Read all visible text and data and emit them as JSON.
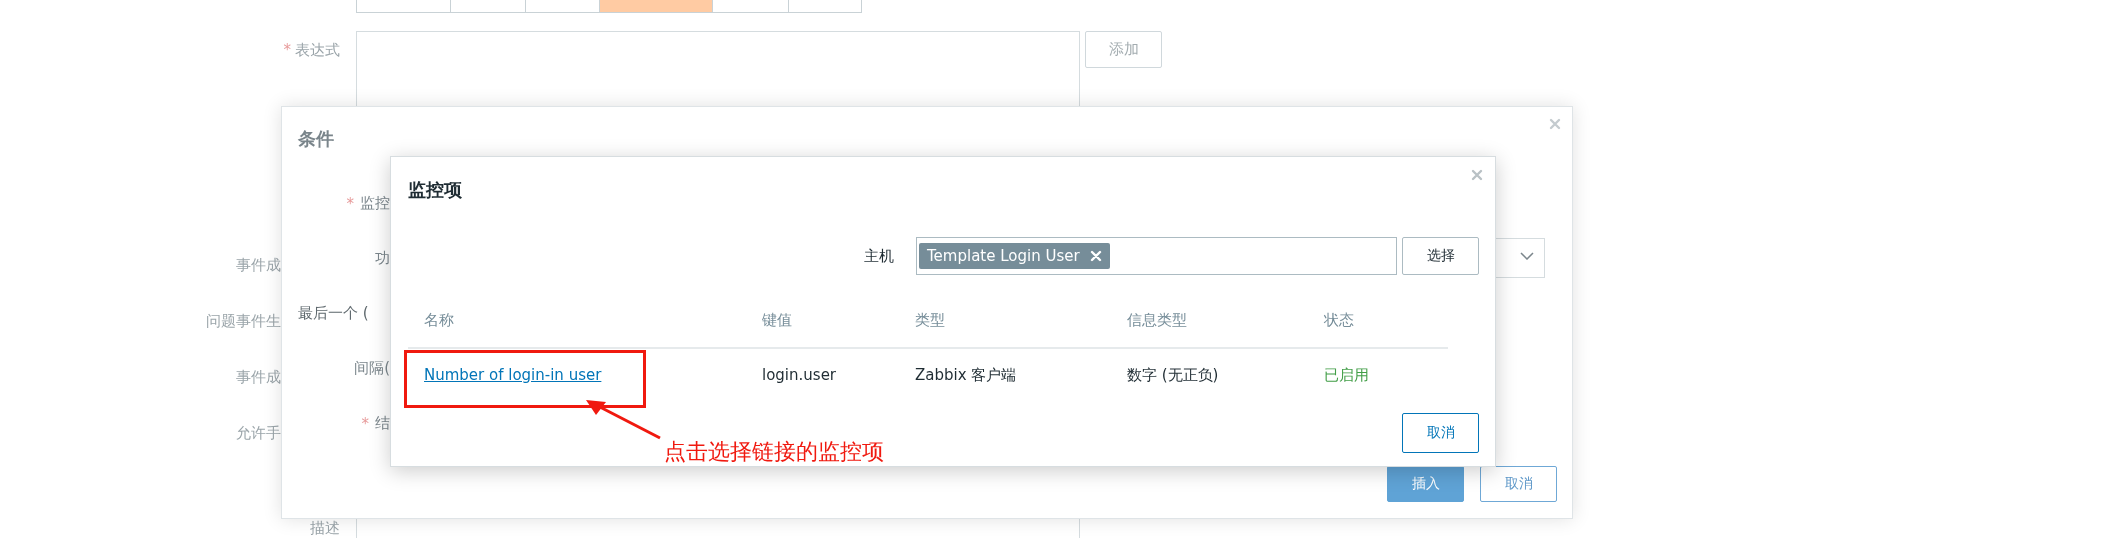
{
  "background_form": {
    "severity_buttons": [
      {
        "selected": false
      },
      {
        "selected": false
      },
      {
        "selected": false
      },
      {
        "selected": true
      },
      {
        "selected": false
      },
      {
        "selected": false
      }
    ],
    "expression": {
      "required_mark": "*",
      "label": "表达式",
      "add_button": "添加"
    },
    "side_labels": [
      "事件成",
      "问题事件生",
      "事件成",
      "允许手"
    ],
    "description_label": "描述"
  },
  "condition_dialog": {
    "title": "条件",
    "fields": [
      {
        "kind": "field",
        "required_mark": "*",
        "label": "监控"
      },
      {
        "kind": "field",
        "label": "功"
      },
      {
        "kind": "heading",
        "label": "最后一个 ("
      },
      {
        "kind": "field",
        "label": "间隔("
      },
      {
        "kind": "field",
        "required_mark": "*",
        "label": "结"
      }
    ],
    "buttons": [
      {
        "label": "插入",
        "kind": "primary"
      },
      {
        "label": "取消",
        "kind": "secondary"
      }
    ]
  },
  "item_dialog": {
    "title": "监控项",
    "host_label": "主机",
    "host_tags": [
      "Template Login User"
    ],
    "select_button": "选择",
    "columns": [
      "名称",
      "键值",
      "类型",
      "信息类型",
      "状态"
    ],
    "rows": [
      {
        "name": "Number of login-in user",
        "key": "login.user",
        "type": "Zabbix 客户端",
        "info_type": "数字 (无正负)",
        "status": "已启用",
        "enabled": true
      }
    ],
    "cancel_button": "取消"
  },
  "annotation": {
    "text": "点击选择链接的监控项"
  }
}
